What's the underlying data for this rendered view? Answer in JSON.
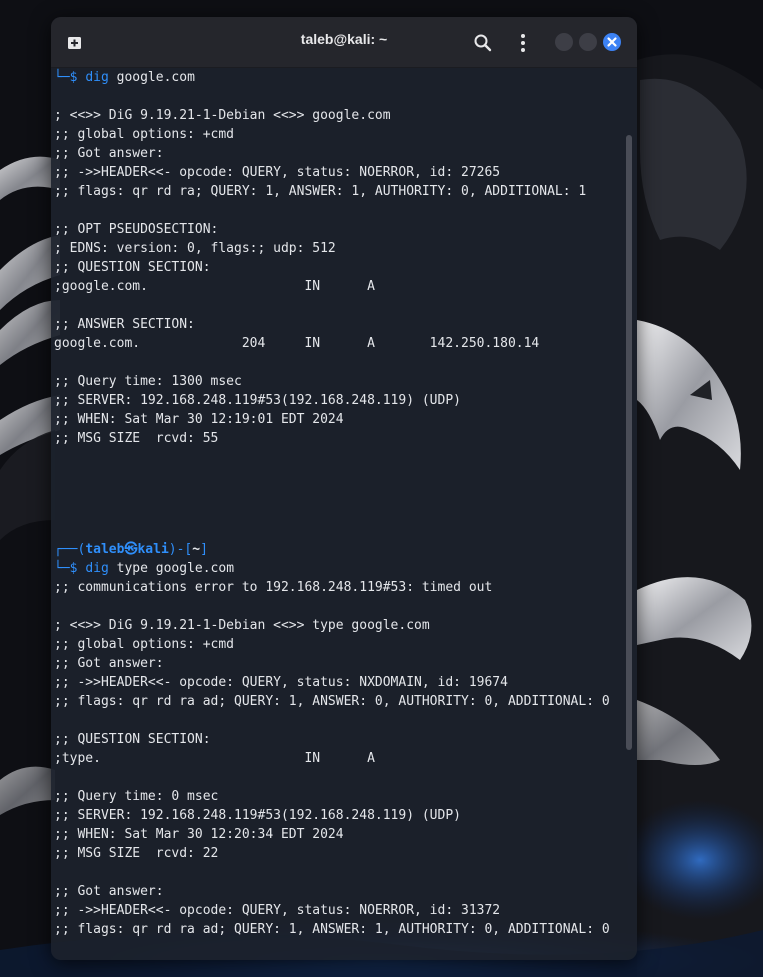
{
  "window": {
    "title": "taleb@kali: ~",
    "accent_color": "#3c82f4"
  },
  "titlebar": {
    "new_tab_icon": "new-tab-icon",
    "search_icon": "search-icon",
    "menu_icon": "kebab-menu-icon",
    "minimize_icon": "minimize-icon",
    "maximize_icon": "maximize-icon",
    "close_icon": "close-icon"
  },
  "terminal": {
    "prompt_corner_top": "┌──(",
    "prompt_user": "taleb",
    "prompt_at_symbol": "㉿",
    "prompt_host": "kali",
    "prompt_close_bracket": ")-[",
    "prompt_path": "~",
    "prompt_end_bracket": "]",
    "prompt_corner_bottom": "└─",
    "prompt_dollar": "$",
    "cmd1_name": "dig",
    "cmd1_args": " google.com",
    "cmd2_name": "dig",
    "cmd2_args": " type google.com",
    "output1": [
      "; <<>> DiG 9.19.21-1-Debian <<>> google.com",
      ";; global options: +cmd",
      ";; Got answer:",
      ";; ->>HEADER<<- opcode: QUERY, status: NOERROR, id: 27265",
      ";; flags: qr rd ra; QUERY: 1, ANSWER: 1, AUTHORITY: 0, ADDITIONAL: 1",
      "",
      ";; OPT PSEUDOSECTION:",
      "; EDNS: version: 0, flags:; udp: 512",
      ";; QUESTION SECTION:",
      ";google.com.                    IN      A",
      "",
      ";; ANSWER SECTION:",
      "google.com.             204     IN      A       142.250.180.14",
      "",
      ";; Query time: 1300 msec",
      ";; SERVER: 192.168.248.119#53(192.168.248.119) (UDP)",
      ";; WHEN: Sat Mar 30 12:19:01 EDT 2024",
      ";; MSG SIZE  rcvd: 55"
    ],
    "output2": [
      ";; communications error to 192.168.248.119#53: timed out",
      "",
      "; <<>> DiG 9.19.21-1-Debian <<>> type google.com",
      ";; global options: +cmd",
      ";; Got answer:",
      ";; ->>HEADER<<- opcode: QUERY, status: NXDOMAIN, id: 19674",
      ";; flags: qr rd ra ad; QUERY: 1, ANSWER: 0, AUTHORITY: 0, ADDITIONAL: 0",
      "",
      ";; QUESTION SECTION:",
      ";type.                          IN      A",
      "",
      ";; Query time: 0 msec",
      ";; SERVER: 192.168.248.119#53(192.168.248.119) (UDP)",
      ";; WHEN: Sat Mar 30 12:20:34 EDT 2024",
      ";; MSG SIZE  rcvd: 22",
      "",
      ";; Got answer:",
      ";; ->>HEADER<<- opcode: QUERY, status: NOERROR, id: 31372",
      ";; flags: qr rd ra ad; QUERY: 1, ANSWER: 1, AUTHORITY: 0, ADDITIONAL: 0"
    ]
  }
}
